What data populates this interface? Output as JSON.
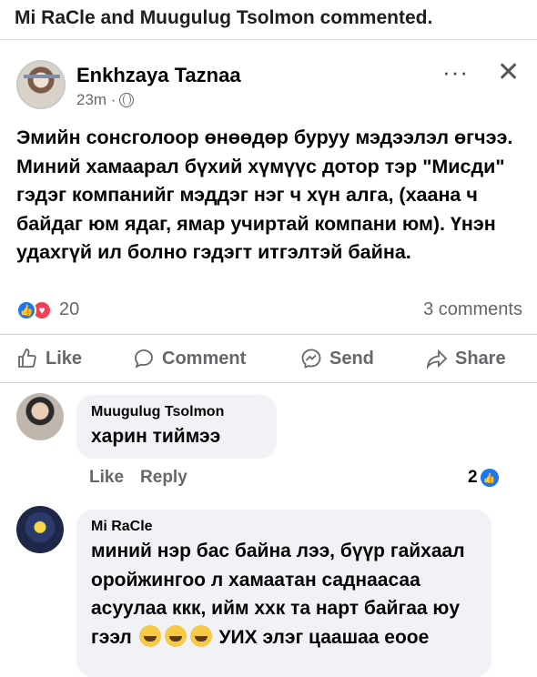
{
  "notification": {
    "text": "Mi RaCle and Muugulug Tsolmon commented."
  },
  "post": {
    "author": "Enkhzaya Taznaa",
    "time": "23m ·",
    "more_label": "···",
    "close_label": "✕",
    "text": "Эмийн сонсголоор өнөөдөр буруу мэдээлэл өгчээ. Миний хамаарал бүхий хүмүүс дотор тэр \"Мисди\" гэдэг компанийг мэддэг нэг ч хүн алга, (хаана ч байдаг юм ядаг, ямар учиртай компани юм). Үнэн удахгүй ил болно гэдэгт итгэлтэй байна.",
    "reactions_count": "20",
    "comments_count": "3 comments"
  },
  "actions": {
    "like": "Like",
    "comment": "Comment",
    "send": "Send",
    "share": "Share"
  },
  "comments": [
    {
      "name": "Muugulug Tsolmon",
      "text": "харин тиймээ",
      "like_label": "Like",
      "reply_label": "Reply",
      "reaction_count": "2"
    },
    {
      "name": "Mi RaCle",
      "text_before_emoji": "миний нэр бас байна лээ, бүүр гайхаал оройжингоо л хамаатан саднаасаа асуулаа ккк, ийм ххк та нарт байгаа юу гээл",
      "text_after_emoji": "УИХ элэг цаашаа еоое",
      "emoji": "joy-emoji"
    }
  ],
  "colors": {
    "accent": "#1877f2",
    "love": "#f33e58",
    "muted_text": "#65676b",
    "bubble": "#f0f2f5"
  }
}
